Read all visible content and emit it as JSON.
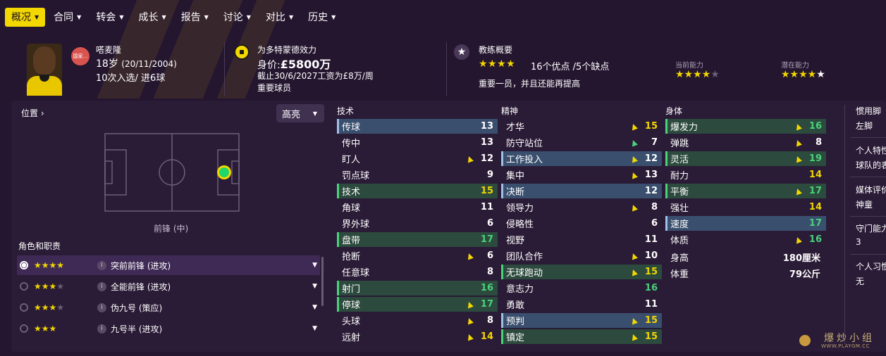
{
  "nav": {
    "tabs": [
      {
        "label": "概况"
      },
      {
        "label": "合同"
      },
      {
        "label": "转会"
      },
      {
        "label": "成长"
      },
      {
        "label": "报告"
      },
      {
        "label": "讨论"
      },
      {
        "label": "对比"
      },
      {
        "label": "历史"
      }
    ]
  },
  "player": {
    "nation_text": "国家...",
    "name": "嗒麦隆",
    "age": "18岁",
    "dob": "(20/11/2004)",
    "caps": "10次入选/ 进6球"
  },
  "club": {
    "plays_for": "为多特蒙德效力",
    "value_prefix": "身价:",
    "value_amount": "£5800万",
    "contract": "截止30/6/2027工资为£8万/周",
    "status": "重要球员"
  },
  "coach": {
    "title": "教练概要",
    "stars": "★★★★",
    "pros_cons": "16个优点 /5个缺点",
    "summary": "重要一员，并且还能再提高",
    "current_ability_label": "当前能力",
    "current_ability_stars": 4,
    "potential_ability_label": "潜在能力",
    "potential_ability_stars": 4.5
  },
  "left": {
    "position_label": "位置 ›",
    "highlight_label": "高亮",
    "pitch_position": "前锋 (中)",
    "roles_title": "角色和职责",
    "roles": [
      {
        "stars": "★★★★",
        "empty": "",
        "label": "突前前锋 (进攻)",
        "selected": true
      },
      {
        "stars": "★★★",
        "empty": "★",
        "label": "全能前锋 (进攻)",
        "selected": false
      },
      {
        "stars": "★★★",
        "empty": "★",
        "label": "伪九号 (策应)",
        "selected": false
      },
      {
        "stars": "★★★",
        "empty": "",
        "label": "九号半 (进攻)",
        "selected": false
      }
    ]
  },
  "attributes": {
    "technical_title": "技术",
    "mental_title": "精神",
    "physical_title": "身体",
    "technical": [
      {
        "name": "传球",
        "value": "13",
        "style": "hl",
        "arrow": "",
        "color": ""
      },
      {
        "name": "传中",
        "value": "13",
        "style": "",
        "arrow": "",
        "color": ""
      },
      {
        "name": "盯人",
        "value": "12",
        "style": "",
        "arrow": "up",
        "color": ""
      },
      {
        "name": "罚点球",
        "value": "9",
        "style": "",
        "arrow": "",
        "color": ""
      },
      {
        "name": "技术",
        "value": "15",
        "style": "grn",
        "arrow": "",
        "color": "y"
      },
      {
        "name": "角球",
        "value": "11",
        "style": "",
        "arrow": "",
        "color": ""
      },
      {
        "name": "界外球",
        "value": "6",
        "style": "",
        "arrow": "",
        "color": ""
      },
      {
        "name": "盘带",
        "value": "17",
        "style": "grn",
        "arrow": "",
        "color": "g"
      },
      {
        "name": "抢断",
        "value": "6",
        "style": "",
        "arrow": "up",
        "color": ""
      },
      {
        "name": "任意球",
        "value": "8",
        "style": "",
        "arrow": "",
        "color": ""
      },
      {
        "name": "射门",
        "value": "16",
        "style": "grn",
        "arrow": "",
        "color": "g"
      },
      {
        "name": "停球",
        "value": "17",
        "style": "grn",
        "arrow": "up",
        "color": "g"
      },
      {
        "name": "头球",
        "value": "8",
        "style": "",
        "arrow": "up",
        "color": ""
      },
      {
        "name": "远射",
        "value": "14",
        "style": "",
        "arrow": "up",
        "color": "y"
      }
    ],
    "mental": [
      {
        "name": "才华",
        "value": "15",
        "style": "",
        "arrow": "up",
        "color": "y"
      },
      {
        "name": "防守站位",
        "value": "7",
        "style": "",
        "arrow": "upg",
        "color": ""
      },
      {
        "name": "工作投入",
        "value": "12",
        "style": "hl",
        "arrow": "up",
        "color": ""
      },
      {
        "name": "集中",
        "value": "13",
        "style": "",
        "arrow": "up",
        "color": ""
      },
      {
        "name": "决断",
        "value": "12",
        "style": "hl",
        "arrow": "",
        "color": ""
      },
      {
        "name": "领导力",
        "value": "8",
        "style": "",
        "arrow": "up",
        "color": ""
      },
      {
        "name": "侵略性",
        "value": "6",
        "style": "",
        "arrow": "",
        "color": ""
      },
      {
        "name": "视野",
        "value": "11",
        "style": "",
        "arrow": "",
        "color": ""
      },
      {
        "name": "团队合作",
        "value": "10",
        "style": "",
        "arrow": "up",
        "color": ""
      },
      {
        "name": "无球跑动",
        "value": "15",
        "style": "grn",
        "arrow": "up",
        "color": "y"
      },
      {
        "name": "意志力",
        "value": "16",
        "style": "",
        "arrow": "",
        "color": "g"
      },
      {
        "name": "勇敢",
        "value": "11",
        "style": "",
        "arrow": "",
        "color": ""
      },
      {
        "name": "预判",
        "value": "15",
        "style": "hl",
        "arrow": "up",
        "color": "y"
      },
      {
        "name": "镇定",
        "value": "15",
        "style": "grn",
        "arrow": "up",
        "color": "y"
      }
    ],
    "physical": [
      {
        "name": "爆发力",
        "value": "16",
        "style": "grn",
        "arrow": "up",
        "color": "g"
      },
      {
        "name": "弹跳",
        "value": "8",
        "style": "",
        "arrow": "up",
        "color": ""
      },
      {
        "name": "灵活",
        "value": "19",
        "style": "grn",
        "arrow": "up",
        "color": "g"
      },
      {
        "name": "耐力",
        "value": "14",
        "style": "",
        "arrow": "",
        "color": "y"
      },
      {
        "name": "平衡",
        "value": "17",
        "style": "grn",
        "arrow": "up",
        "color": "g"
      },
      {
        "name": "强壮",
        "value": "14",
        "style": "",
        "arrow": "",
        "color": "y"
      },
      {
        "name": "速度",
        "value": "17",
        "style": "hl",
        "arrow": "",
        "color": "g"
      },
      {
        "name": "体质",
        "value": "16",
        "style": "",
        "arrow": "up",
        "color": "g"
      }
    ],
    "height_label": "身高",
    "height_value": "180厘米",
    "weight_label": "体重",
    "weight_value": "79公斤"
  },
  "side": {
    "foot_label": "惯用脚",
    "foot_value": "左脚",
    "trait_label": "个人特性",
    "trait_value": "球队的表",
    "media_label": "媒体评价",
    "media_value": "神童",
    "gk_label": "守门能力",
    "gk_value": "3",
    "habit_label": "个人习惯",
    "habit_value": "无"
  },
  "watermark": {
    "text": "爆炒小组",
    "url": "WWW.PLAYGM.CC"
  },
  "colors": {
    "accent": "#f2d700",
    "good": "#4ad27a",
    "highlight_row": "#3a4f6e",
    "green_row": "#2c4a3d"
  }
}
